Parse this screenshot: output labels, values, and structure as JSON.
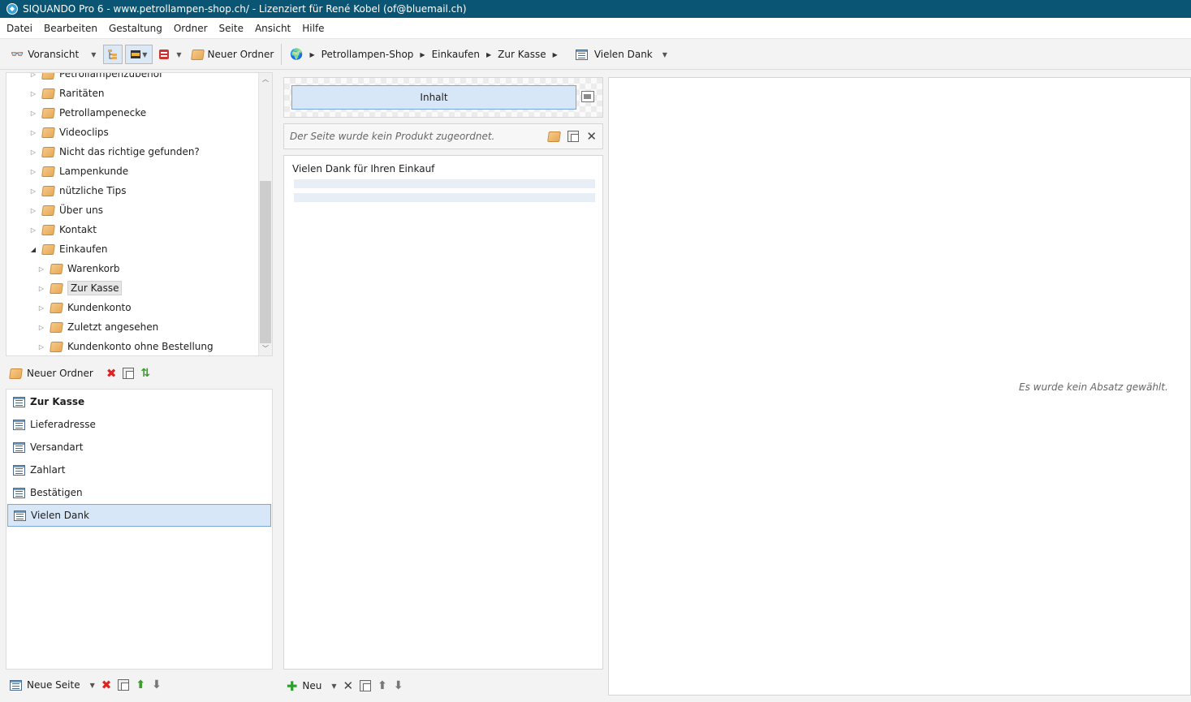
{
  "window": {
    "title": "SIQUANDO Pro 6 - www.petrollampen-shop.ch/ - Lizenziert für René Kobel (of@bluemail.ch)"
  },
  "menu": [
    "Datei",
    "Bearbeiten",
    "Gestaltung",
    "Ordner",
    "Seite",
    "Ansicht",
    "Hilfe"
  ],
  "toolbar": {
    "preview_label": "Voransicht",
    "new_folder_label": "Neuer Ordner",
    "breadcrumb": [
      "Petrollampen-Shop",
      "Einkaufen",
      "Zur Kasse"
    ],
    "current_page": "Vielen Dank"
  },
  "tree": {
    "items": [
      {
        "label": "Petrollampenzubehör",
        "level": 0,
        "expanded": false
      },
      {
        "label": "Raritäten",
        "level": 0,
        "expanded": false
      },
      {
        "label": "Petrollampenecke",
        "level": 0,
        "expanded": false
      },
      {
        "label": "Videoclips",
        "level": 0,
        "expanded": false
      },
      {
        "label": "Nicht das richtige gefunden?",
        "level": 0,
        "expanded": false
      },
      {
        "label": "Lampenkunde",
        "level": 0,
        "expanded": false
      },
      {
        "label": "nützliche Tips",
        "level": 0,
        "expanded": false
      },
      {
        "label": "Über uns",
        "level": 0,
        "expanded": false
      },
      {
        "label": "Kontakt",
        "level": 0,
        "expanded": false
      },
      {
        "label": "Einkaufen",
        "level": 0,
        "expanded": true
      },
      {
        "label": "Warenkorb",
        "level": 1,
        "expanded": false
      },
      {
        "label": "Zur Kasse",
        "level": 1,
        "expanded": false,
        "selected": true
      },
      {
        "label": "Kundenkonto",
        "level": 1,
        "expanded": false
      },
      {
        "label": "Zuletzt angesehen",
        "level": 1,
        "expanded": false
      },
      {
        "label": "Kundenkonto ohne Bestellung",
        "level": 1,
        "expanded": false
      }
    ]
  },
  "folder_actions": {
    "new_folder_label": "Neuer Ordner"
  },
  "pages": {
    "items": [
      {
        "label": "Zur Kasse",
        "bold": true
      },
      {
        "label": "Lieferadresse"
      },
      {
        "label": "Versandart"
      },
      {
        "label": "Zahlart"
      },
      {
        "label": "Bestätigen"
      },
      {
        "label": "Vielen Dank",
        "selected": true
      }
    ]
  },
  "page_actions": {
    "new_page_label": "Neue Seite"
  },
  "editor": {
    "tab_label": "Inhalt",
    "product_message": "Der Seite wurde kein Produkt zugeordnet.",
    "paragraph_heading": "Vielen Dank für Ihren Einkauf",
    "new_label": "Neu"
  },
  "properties": {
    "empty_message": "Es wurde kein Absatz gewählt."
  },
  "colors": {
    "titlebar": "#0b5574",
    "selection": "#d8e7f7",
    "selection_border": "#7aa7d6"
  }
}
